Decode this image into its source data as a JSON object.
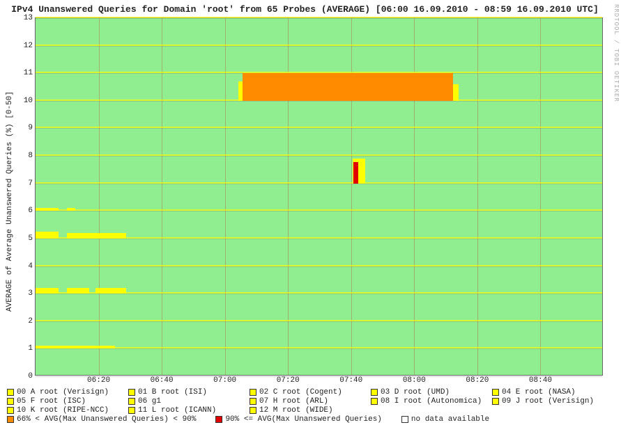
{
  "title": "IPv4 Unanswered Queries for Domain 'root' from 65 Probes (AVERAGE)  [06:00 16.09.2010 - 08:59 16.09.2010 UTC]",
  "ylabel": "AVERAGE of Average Unanswered Queries (%) [0-50]",
  "credit": "RRDTOOL / TOBI OETIKER",
  "legend": {
    "series": [
      "00 A root (Verisign)",
      "01 B root (ISI)",
      "02 C root (Cogent)",
      "03 D root (UMD)",
      "04 E root (NASA)",
      "05 F root (ISC)",
      "06 g1",
      "07 H root (ARL)",
      "08 I root (Autonomica)",
      "09 J root (Verisign)",
      "10 K root (RIPE-NCC)",
      "11 L root (ICANN)",
      "12 M root (WIDE)"
    ],
    "status": [
      {
        "label": "66% < AVG(Max Unanswered Queries) < 90%",
        "color": "#ff8c00"
      },
      {
        "label": "90% <= AVG(Max Unanswered Queries)",
        "color": "#e00000"
      },
      {
        "label": "no data available",
        "color": "#ffffff"
      }
    ]
  },
  "chart_data": {
    "type": "area",
    "x_range": [
      "06:00",
      "09:00"
    ],
    "x_ticks": [
      "06:20",
      "06:40",
      "07:00",
      "07:20",
      "07:40",
      "08:00",
      "08:20",
      "08:40"
    ],
    "y_range": [
      0,
      13
    ],
    "y_ticks": [
      0,
      1,
      2,
      3,
      4,
      5,
      6,
      7,
      8,
      9,
      10,
      11,
      12,
      13
    ],
    "series": [
      {
        "name": "00 A root (Verisign)",
        "baseline": 1,
        "segments": [
          [
            0,
            0.14,
            0.12
          ]
        ]
      },
      {
        "name": "01 B root (ISI)",
        "baseline": 2,
        "segments": []
      },
      {
        "name": "02 C root (Cogent)",
        "baseline": 3,
        "segments": [
          [
            0,
            0.04,
            0.2
          ],
          [
            0.055,
            0.095,
            0.2
          ],
          [
            0.105,
            0.16,
            0.2
          ]
        ]
      },
      {
        "name": "03 D root (UMD)",
        "baseline": 4,
        "segments": []
      },
      {
        "name": "04 E root (NASA)",
        "baseline": 5,
        "segments": [
          [
            0,
            0.04,
            0.25
          ],
          [
            0.055,
            0.16,
            0.2
          ]
        ]
      },
      {
        "name": "05 F root (ISC)",
        "baseline": 6,
        "segments": [
          [
            0,
            0.04,
            0.12
          ],
          [
            0.055,
            0.07,
            0.12
          ]
        ]
      },
      {
        "name": "06 g1",
        "baseline": 7,
        "segments": [],
        "spike": {
          "x": 0.558,
          "w": 0.022,
          "h": 0.9,
          "red_x": 0.559,
          "red_w": 0.009
        }
      },
      {
        "name": "07 H root (ARL)",
        "baseline": 8,
        "segments": []
      },
      {
        "name": "08 I root (Autonomica)",
        "baseline": 9,
        "segments": []
      },
      {
        "name": "09 J root (Verisign)",
        "baseline": 10,
        "segments": [],
        "event": {
          "x_start": 0.365,
          "x_end": 0.735,
          "h": 1.0
        }
      },
      {
        "name": "10 K root (RIPE-NCC)",
        "baseline": 11,
        "segments": []
      },
      {
        "name": "11 L root (ICANN)",
        "baseline": 12,
        "segments": []
      },
      {
        "name": "12 M root (WIDE)",
        "baseline": 13,
        "segments": []
      }
    ],
    "title": "IPv4 Unanswered Queries for Domain 'root' from 65 Probes (AVERAGE)",
    "xlabel": "",
    "ylabel": "AVERAGE of Average Unanswered Queries (%) [0-50]",
    "ylim": [
      0,
      13
    ]
  }
}
